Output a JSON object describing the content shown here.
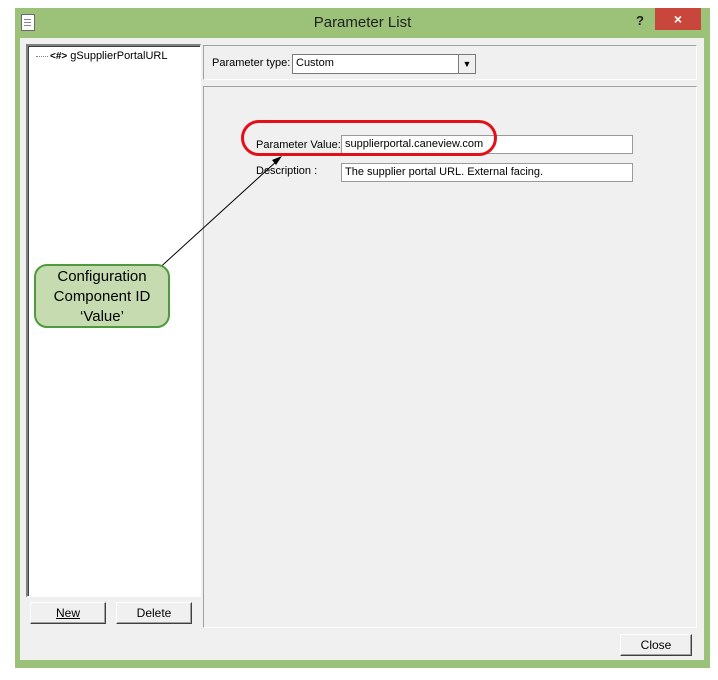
{
  "window": {
    "title": "Parameter List",
    "help_label": "?",
    "close_label": "×"
  },
  "tree": {
    "item_icon": "<#>",
    "item_label": "gSupplierPortalURL"
  },
  "type_bar": {
    "label": "Parameter type:",
    "value": "Custom",
    "arrow": "▼"
  },
  "fields": {
    "value_label": "Parameter Value:",
    "value": "supplierportal.caneview.com",
    "description_label": "Description :",
    "description": "The supplier portal URL. External facing."
  },
  "buttons": {
    "new": "New",
    "delete": "Delete",
    "close": "Close"
  },
  "annotation": {
    "line1": "Configuration",
    "line2": "Component ID",
    "line3": "‘Value’"
  },
  "colors": {
    "frame": "#9cc27a",
    "close_button": "#c9463d",
    "highlight": "#e3101a",
    "callout_fill": "#c6dcb0",
    "callout_border": "#4f9a3c"
  }
}
